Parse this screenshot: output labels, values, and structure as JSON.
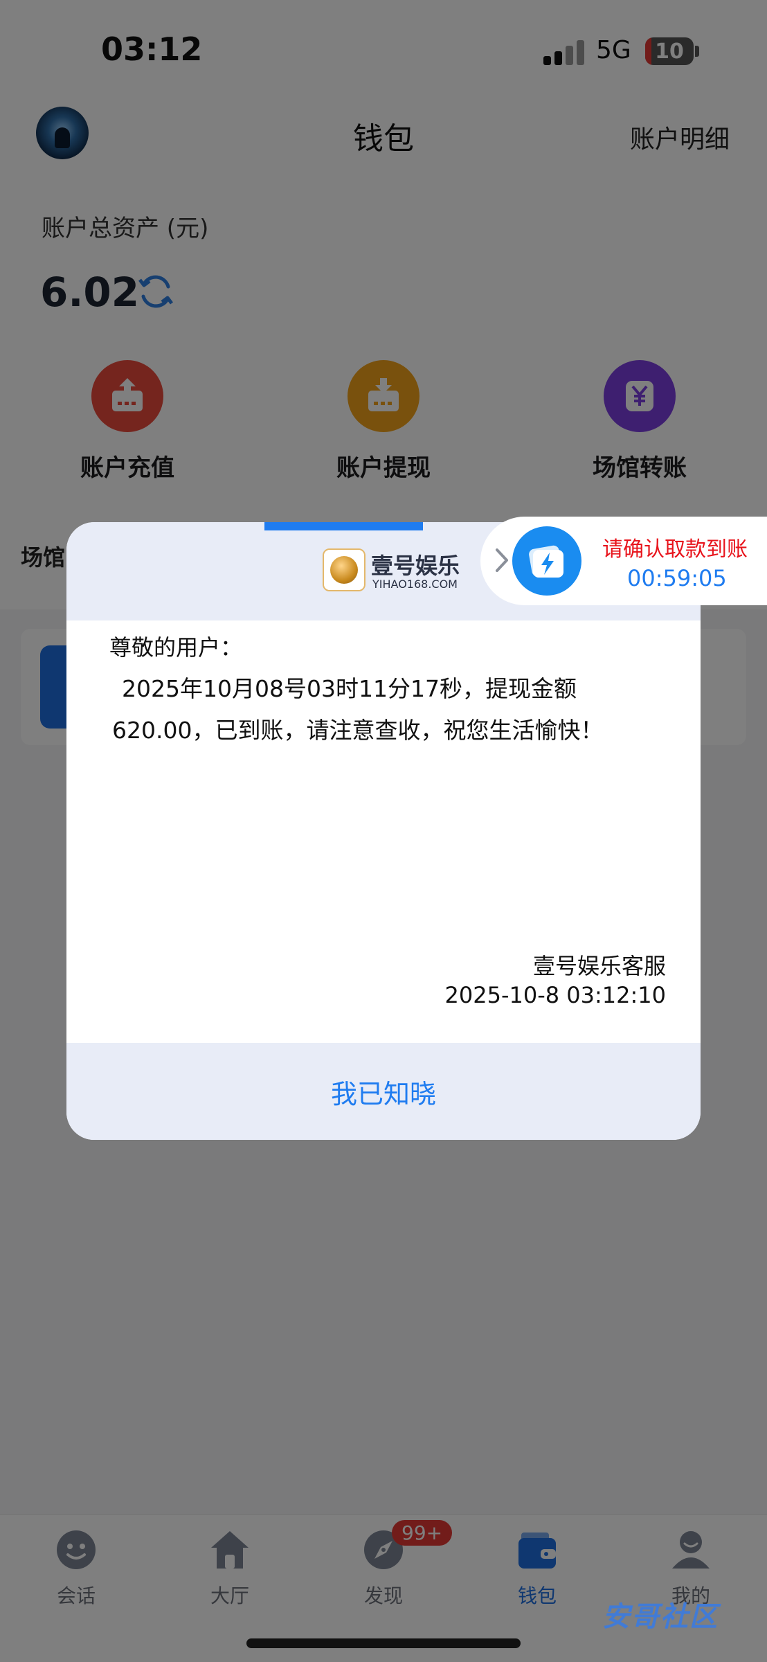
{
  "status_bar": {
    "time": "03:12",
    "network": "5G",
    "battery": "10"
  },
  "header": {
    "title": "钱包",
    "right_link": "账户明细"
  },
  "assets": {
    "label": "账户总资产 (元)",
    "value": "6.02"
  },
  "actions": [
    {
      "label": "账户充值",
      "icon": "deposit-icon",
      "color": "#ea4a3c"
    },
    {
      "label": "账户提现",
      "icon": "withdraw-icon",
      "color": "#f2a31b"
    },
    {
      "label": "场馆转账",
      "icon": "yen-transfer-icon",
      "color": "#7d3fe0"
    }
  ],
  "venue_label": "场馆",
  "tabs": [
    {
      "label": "会话",
      "icon": "chat-icon"
    },
    {
      "label": "大厅",
      "icon": "home-icon"
    },
    {
      "label": "发现",
      "icon": "compass-icon",
      "badge": "99+"
    },
    {
      "label": "钱包",
      "icon": "wallet-icon",
      "active": true
    },
    {
      "label": "我的",
      "icon": "user-icon"
    }
  ],
  "watermark": "安哥社区",
  "dialog": {
    "brand_name": "壹号娱乐",
    "brand_site": "YIHAO168.COM",
    "brand_logo_text": "YIHAO168.COM",
    "greeting": "尊敬的用户：",
    "message_line1": "2025年10月08号03时11分17秒，提现金额",
    "message_line2": "620.00，已到账，请注意查收，祝您生活愉快！",
    "signature_name": "壹号娱乐客服",
    "signature_time": "2025-10-8 03:12:10",
    "button": "我已知晓",
    "progress": 0.25
  },
  "reminder": {
    "title": "请确认取款到账",
    "timer": "00:59:05"
  },
  "colors": {
    "accent": "#1f7cf0",
    "alert": "#e8141c"
  }
}
